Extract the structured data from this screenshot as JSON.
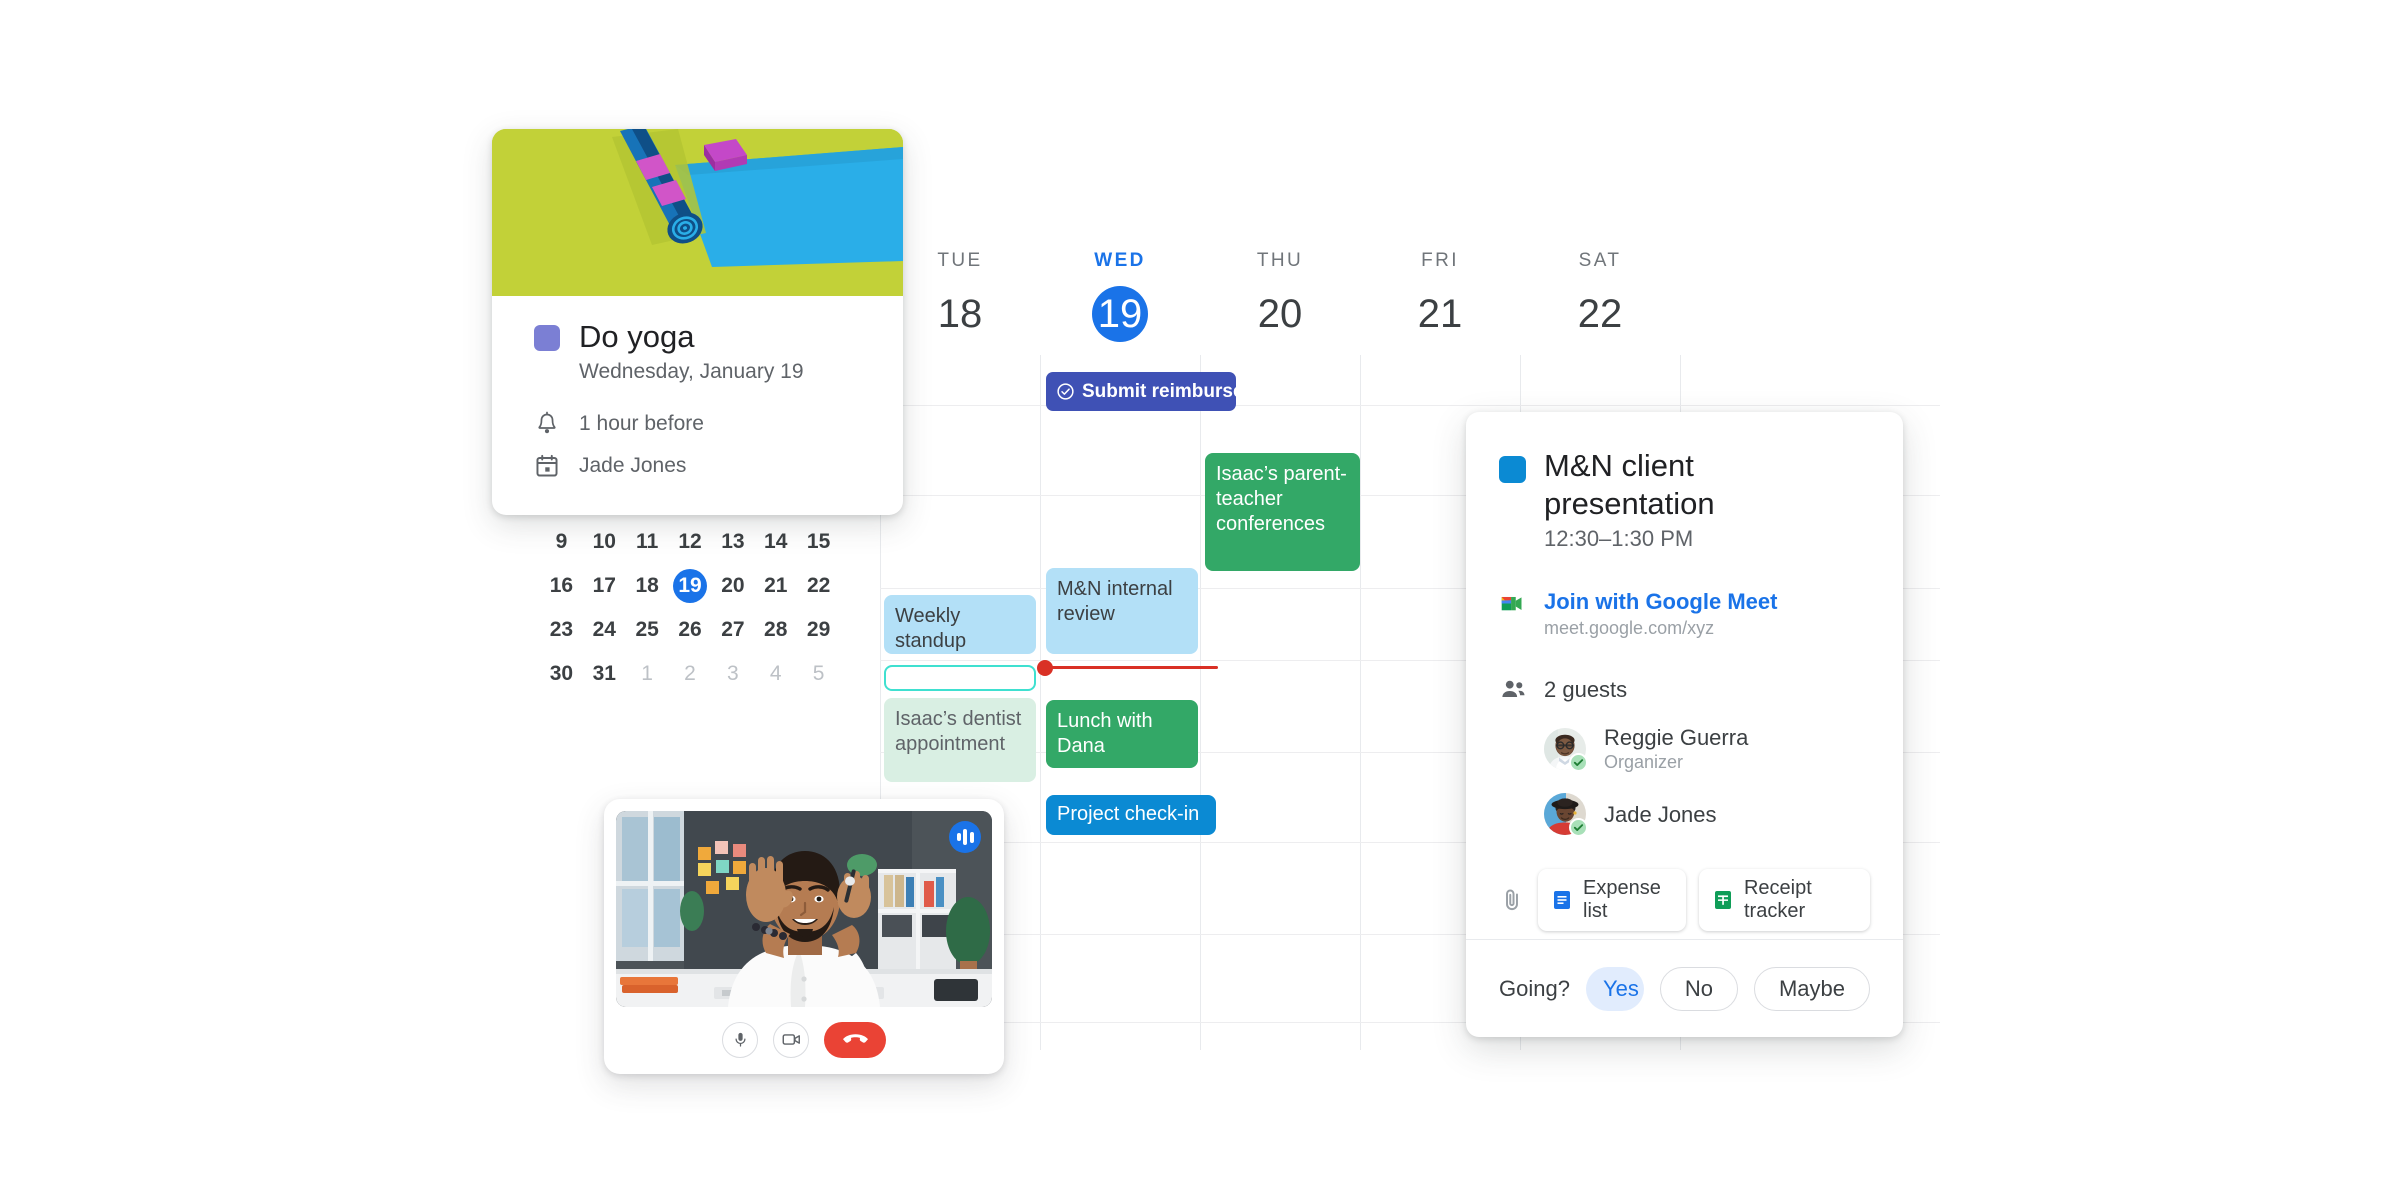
{
  "week_view": {
    "days": [
      {
        "dow": "TUE",
        "num": "18",
        "today": false
      },
      {
        "dow": "WED",
        "num": "19",
        "today": true
      },
      {
        "dow": "THU",
        "num": "20",
        "today": false
      },
      {
        "dow": "FRI",
        "num": "21",
        "today": false
      },
      {
        "dow": "SAT",
        "num": "22",
        "today": false
      }
    ],
    "events": [
      {
        "title": "Submit reimbursement",
        "kind": "task",
        "icon": "check-circle-icon"
      },
      {
        "title": "Isaac’s parent-teacher conferences",
        "kind": "green-solid"
      },
      {
        "title": "Weekly standup",
        "kind": "blue-light"
      },
      {
        "title": "M&N internal review",
        "kind": "blue-light"
      },
      {
        "title": "",
        "kind": "outline-cyan"
      },
      {
        "title": "Isaac’s dentist appointment",
        "kind": "green-pale"
      },
      {
        "title": "Lunch with Dana",
        "kind": "green-solid"
      },
      {
        "title": "Project check-in",
        "kind": "blue-solid"
      }
    ],
    "now_indicator_color": "#d93025"
  },
  "mini_month": {
    "rows": [
      [
        {
          "d": "9"
        },
        {
          "d": "10"
        },
        {
          "d": "11"
        },
        {
          "d": "12"
        },
        {
          "d": "13"
        },
        {
          "d": "14"
        },
        {
          "d": "15"
        }
      ],
      [
        {
          "d": "16"
        },
        {
          "d": "17"
        },
        {
          "d": "18"
        },
        {
          "d": "19",
          "selected": true
        },
        {
          "d": "20"
        },
        {
          "d": "21"
        },
        {
          "d": "22"
        }
      ],
      [
        {
          "d": "23"
        },
        {
          "d": "24"
        },
        {
          "d": "25"
        },
        {
          "d": "26"
        },
        {
          "d": "27"
        },
        {
          "d": "28"
        },
        {
          "d": "29"
        }
      ],
      [
        {
          "d": "30"
        },
        {
          "d": "31"
        },
        {
          "d": "1",
          "dim": true
        },
        {
          "d": "2",
          "dim": true
        },
        {
          "d": "3",
          "dim": true
        },
        {
          "d": "4",
          "dim": true
        },
        {
          "d": "5",
          "dim": true
        }
      ]
    ],
    "selected_color": "#1a73e8"
  },
  "yoga_card": {
    "title": "Do yoga",
    "date": "Wednesday, January 19",
    "reminder": "1 hour before",
    "calendar_owner": "Jade Jones",
    "swatch_color": "#7b7fd4",
    "hero_bg_color": "#c2d138",
    "reminder_icon": "bell-icon",
    "calendar_icon": "calendar-icon"
  },
  "detail_card": {
    "title": "M&N client presentation",
    "time": "12:30–1:30 PM",
    "swatch_color": "#0b8ad3",
    "meet": {
      "icon": "google-meet-icon",
      "link_label": "Join with Google Meet",
      "url": "meet.google.com/xyz"
    },
    "guests_icon": "people-icon",
    "guests_label": "2 guests",
    "guests": [
      {
        "name": "Reggie Guerra",
        "role": "Organizer",
        "accepted": true
      },
      {
        "name": "Jade Jones",
        "role": "",
        "accepted": true
      }
    ],
    "attachments_icon": "paperclip-icon",
    "attachments": [
      {
        "label": "Expense list",
        "icon": "google-docs-icon",
        "color": "#1a73e8"
      },
      {
        "label": "Receipt tracker",
        "icon": "google-sheets-icon",
        "color": "#0f9d58"
      }
    ],
    "rsvp": {
      "question": "Going?",
      "yes": "Yes",
      "yes_caret_icon": "chevron-down-icon",
      "no": "No",
      "maybe": "Maybe",
      "selected": "Yes",
      "selected_color": "#1a73e8"
    }
  },
  "meet_widget": {
    "badge_icon": "audio-waveform-icon",
    "controls": [
      {
        "name": "microphone-icon",
        "label": "Microphone"
      },
      {
        "name": "camera-icon",
        "label": "Camera"
      },
      {
        "name": "hang-up-icon",
        "label": "Leave call"
      }
    ],
    "hangup_color": "#ea4335"
  }
}
